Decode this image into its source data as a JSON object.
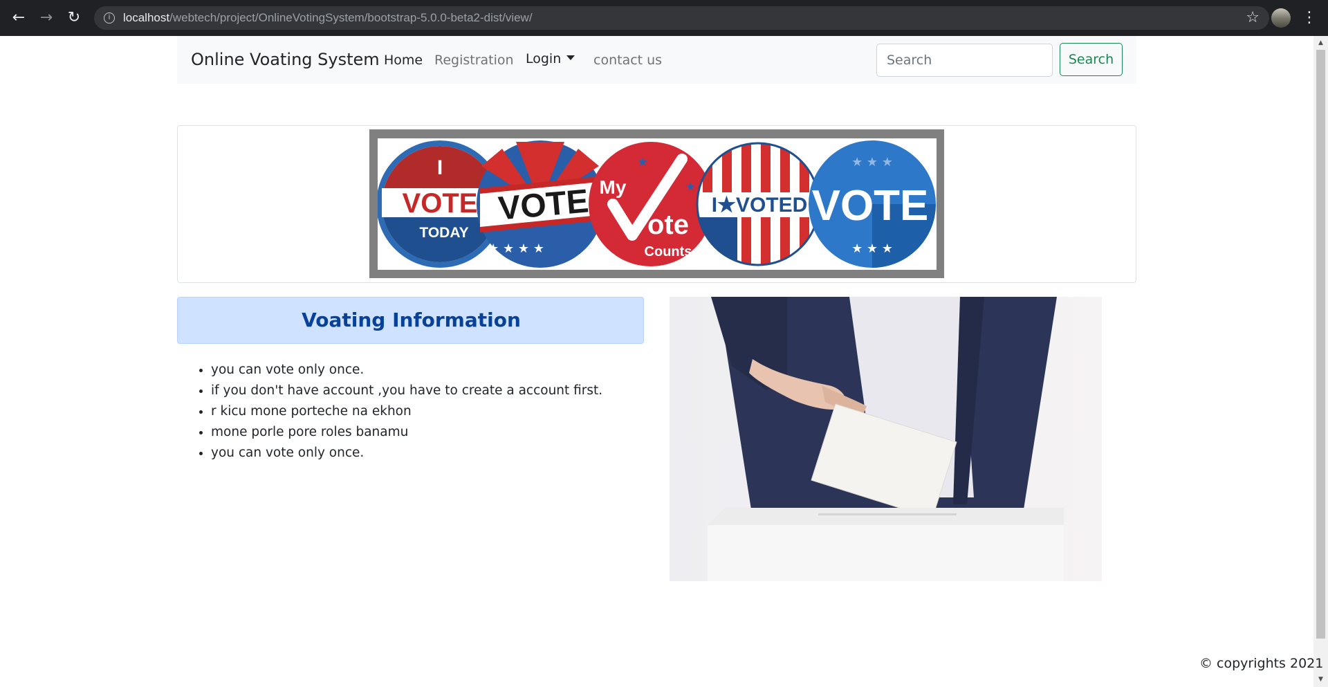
{
  "browser": {
    "url_host": "localhost",
    "url_path": "/webtech/project/OnlineVotingSystem/bootstrap-5.0.0-beta2-dist/view/",
    "icons": [
      "back-arrow-icon",
      "forward-arrow-icon",
      "reload-icon",
      "info-icon",
      "bookmark-star-icon",
      "profile-avatar",
      "kebab-menu-icon"
    ]
  },
  "navbar": {
    "brand": "Online Voating System",
    "links": [
      {
        "label": "Home",
        "active": true
      },
      {
        "label": "Registration",
        "active": false
      },
      {
        "label": "Login",
        "active": true,
        "dropdown": true
      },
      {
        "label": "contact us",
        "active": false
      }
    ],
    "search_placeholder": "Search",
    "search_button": "Search"
  },
  "banner": {
    "badges": [
      {
        "top": "I",
        "main": "VOTE",
        "bottom": "TODAY"
      },
      {
        "main": "VOTE"
      },
      {
        "top": "My",
        "main": "ote",
        "bottom": "Counts"
      },
      {
        "main": "I★VOTED"
      },
      {
        "main": "VOTE"
      }
    ]
  },
  "info": {
    "title": "Voating Information",
    "items": [
      "you can vote only once.",
      "if you don't have account ,you have to create a account first.",
      "r kicu mone porteche na ekhon",
      "mone porle pore roles banamu",
      "you can vote only once."
    ]
  },
  "footer": {
    "text": "© copyrights 2021"
  },
  "colors": {
    "primary_alert_bg": "#cfe2ff",
    "primary_alert_text": "#084298",
    "success": "#198754",
    "navbar_bg": "#f8f9fa"
  }
}
